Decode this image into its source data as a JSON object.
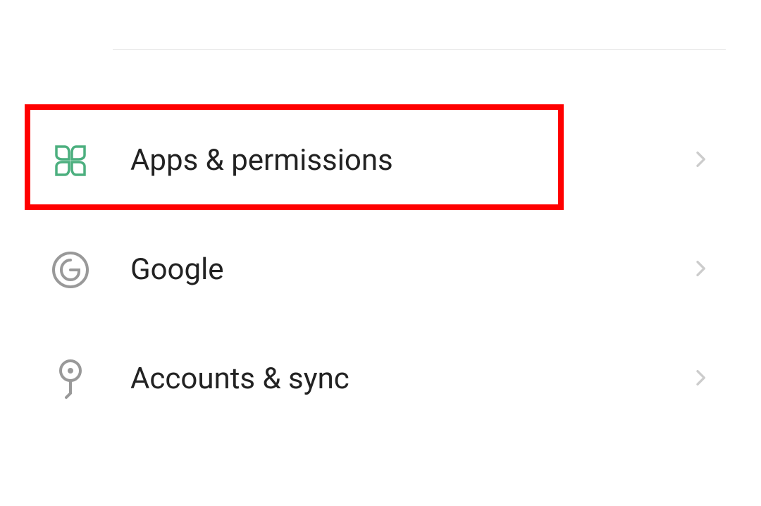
{
  "settings": {
    "items": [
      {
        "label": "Apps & permissions"
      },
      {
        "label": "Google"
      },
      {
        "label": "Accounts & sync"
      }
    ]
  }
}
